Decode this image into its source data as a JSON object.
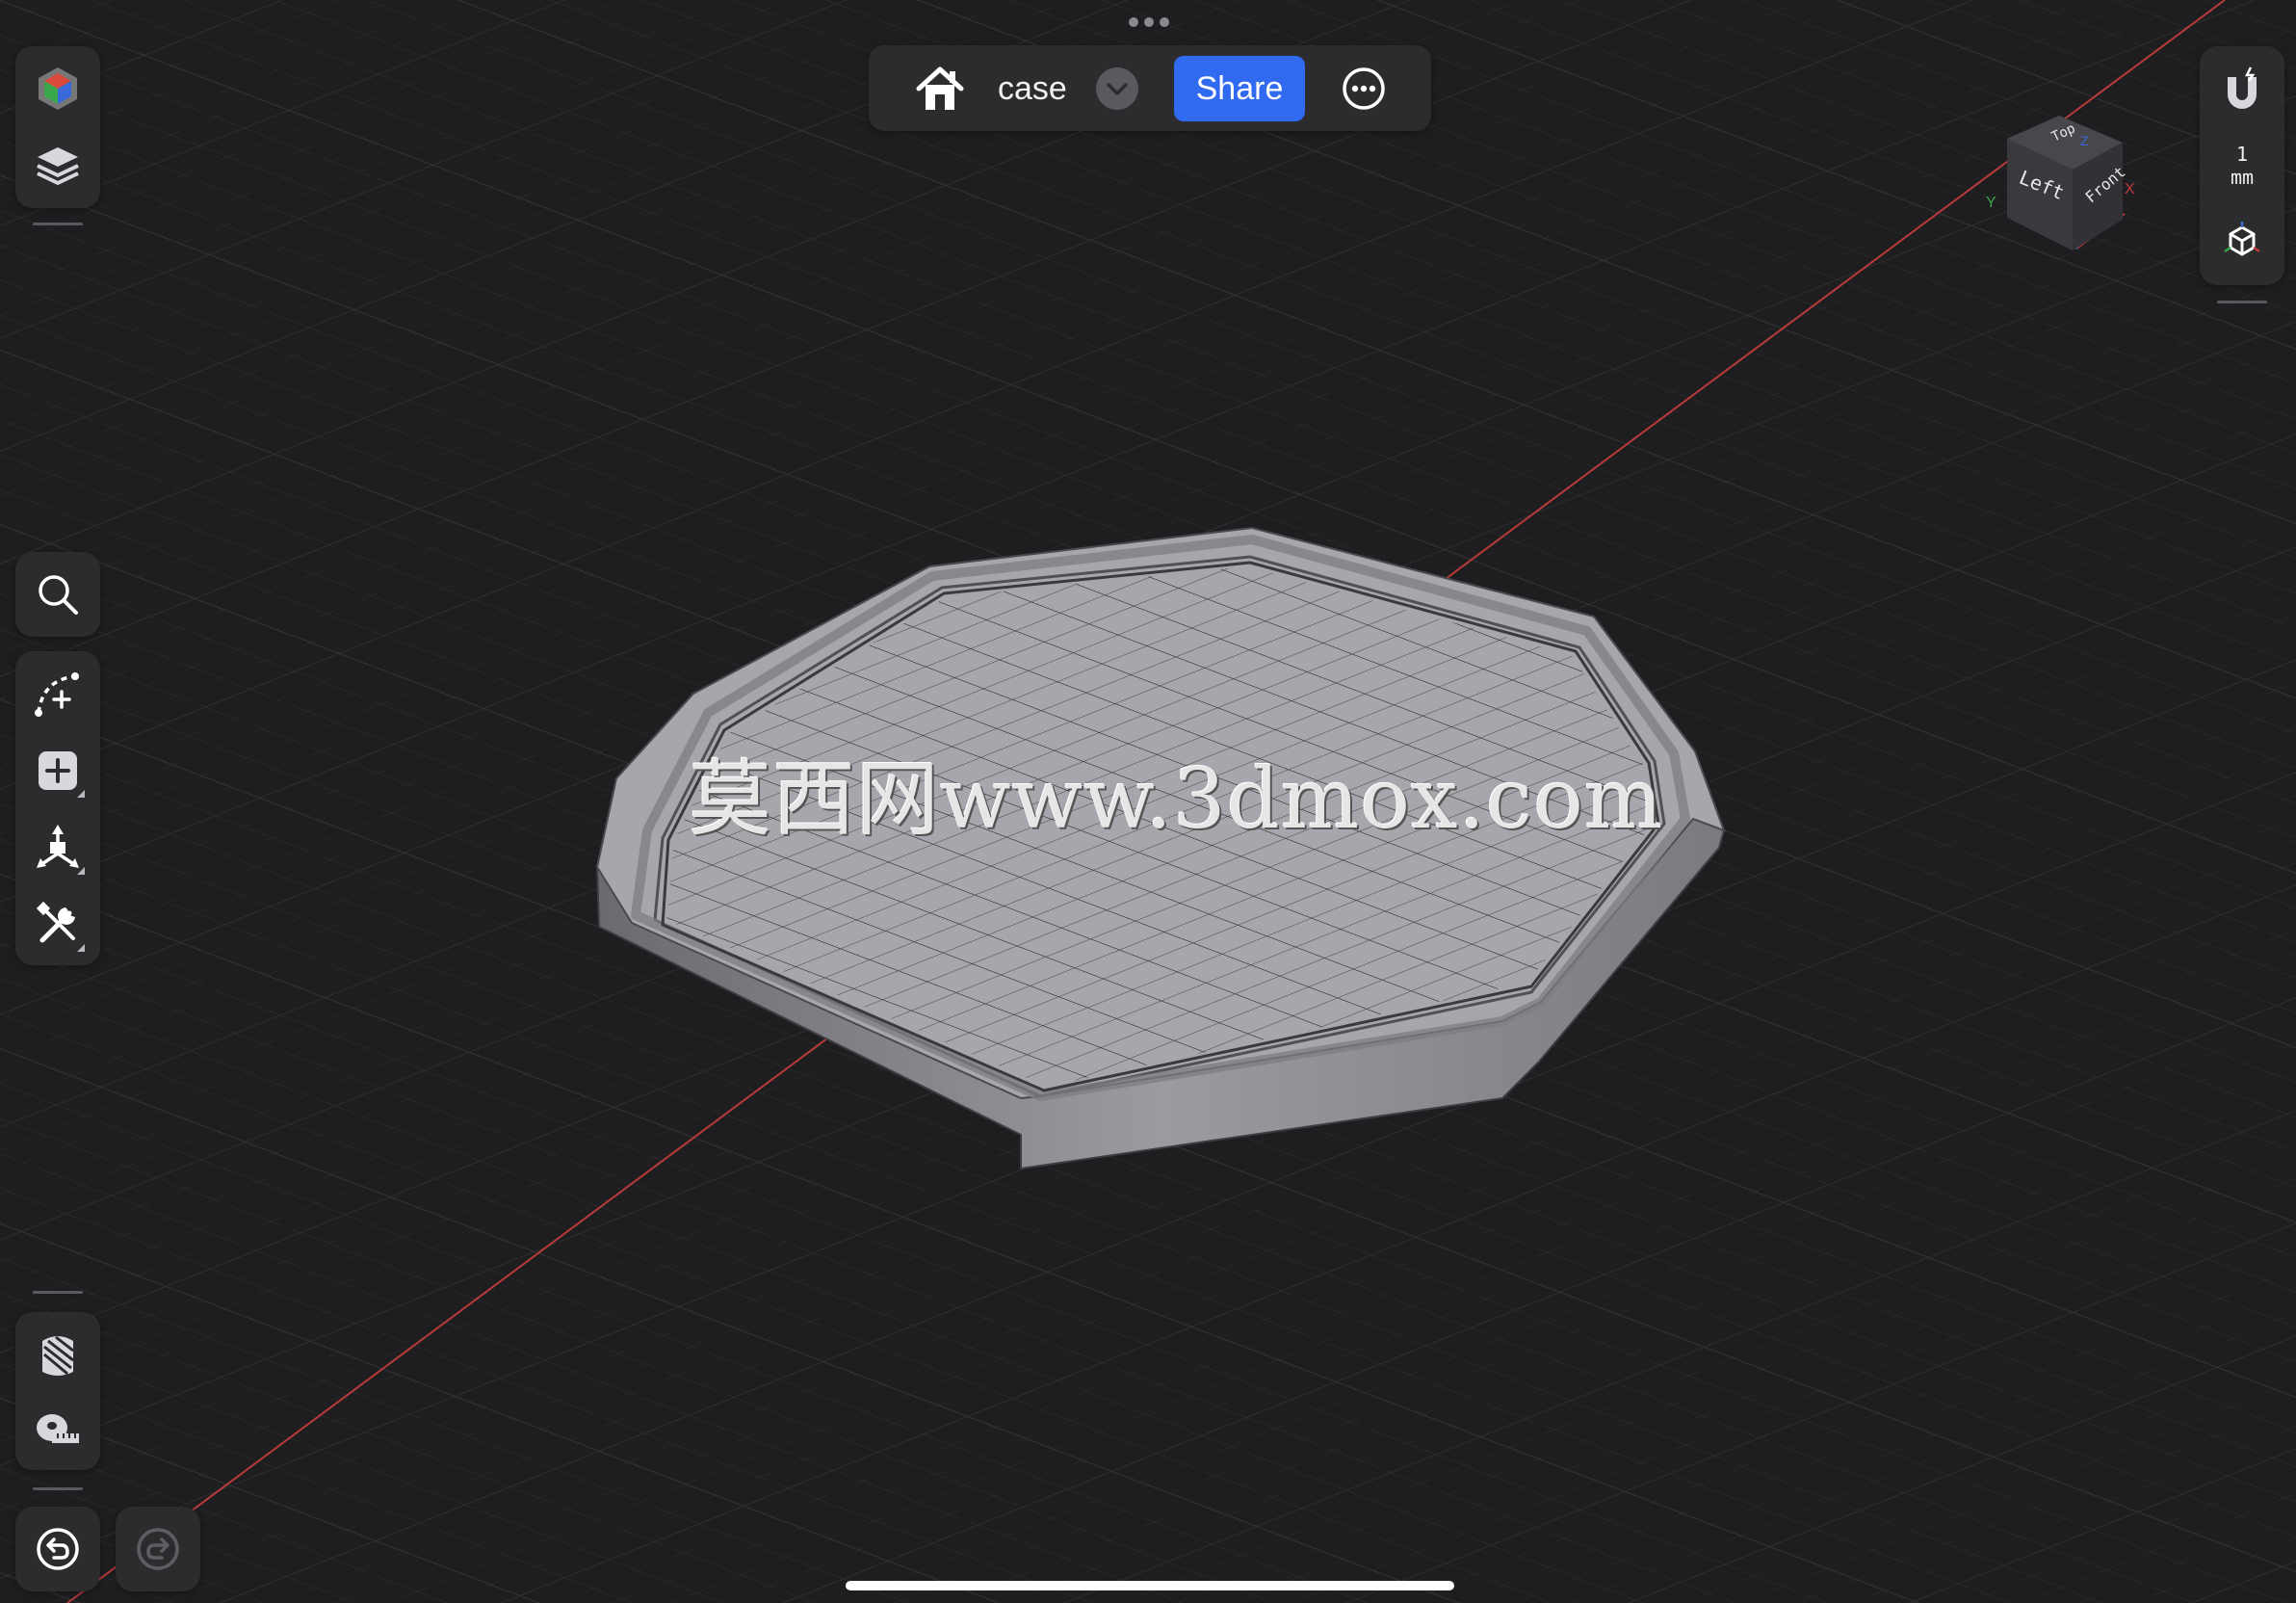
{
  "document": {
    "title": "case"
  },
  "toolbar": {
    "share_label": "Share"
  },
  "viewcube": {
    "top": "Top",
    "left": "Left",
    "front": "Front",
    "axis_x": "X",
    "axis_y": "Y",
    "axis_z": "Z"
  },
  "units": {
    "value": "1",
    "unit": "mm"
  },
  "watermark": {
    "text": "莫西网www.3dmox.com"
  },
  "colors": {
    "background": "#1e1e20",
    "panel": "#2c2c2e",
    "accent": "#2f6af0",
    "x_axis": "#c0393b",
    "model": "#8e8e94"
  },
  "icons": {
    "left_top": [
      "appearance-cube-icon",
      "layers-icon"
    ],
    "left_mid": [
      "search-icon"
    ],
    "left_tools": [
      "sketch-curve-icon",
      "add-primitive-icon",
      "transform-icon",
      "tools-icon"
    ],
    "left_bottom": [
      "section-view-icon",
      "measure-tape-icon"
    ],
    "history": [
      "undo-icon",
      "redo-icon"
    ],
    "top_bar": [
      "home-icon",
      "chevron-down-icon",
      "more-icon"
    ],
    "right_panel": [
      "snap-magnet-icon",
      "view-orientation-icon"
    ]
  }
}
